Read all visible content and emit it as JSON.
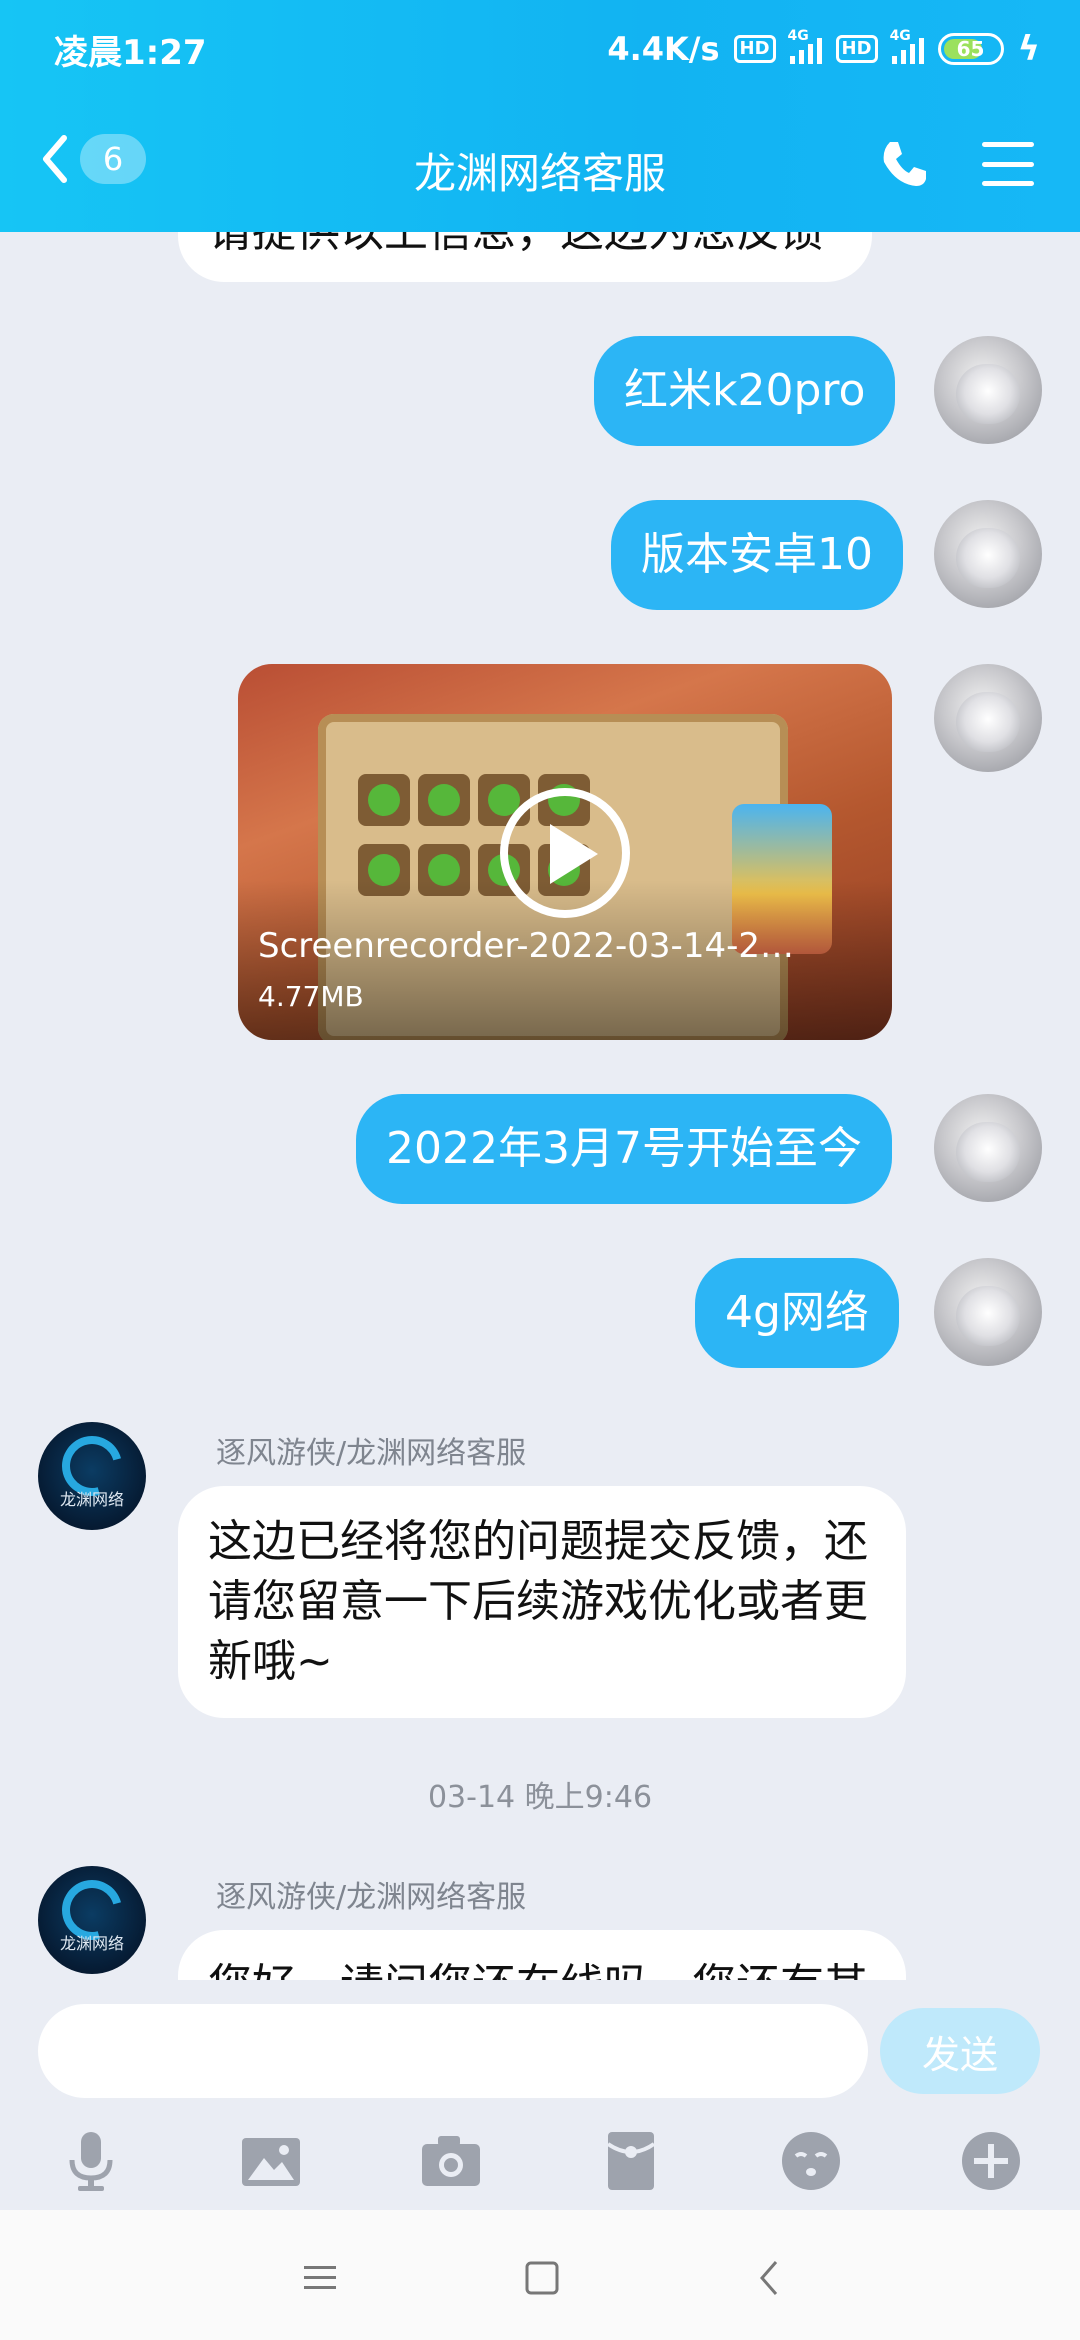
{
  "status_bar": {
    "time": "凌晨1:27",
    "network_speed": "4.4K/s",
    "hd1": "HD",
    "net1": "4G",
    "hd2": "HD",
    "net2": "4G",
    "battery": "65"
  },
  "header": {
    "unread_count": "6",
    "title": "龙渊网络客服"
  },
  "messages": {
    "m0_partial": "请提供以上信息，这边为您反馈",
    "m1": "红米k20pro",
    "m2": "版本安卓10",
    "video": {
      "name": "Screenrecorder-2022-03-14-2…",
      "size": "4.77MB"
    },
    "m3": "2022年3月7号开始至今",
    "m4": "4g网络",
    "sender1": "逐风游侠/龙渊网络客服",
    "reply1": "这边已经将您的问题提交反馈，还请您留意一下后续游戏优化或者更新哦~",
    "timestamp": "03-14 晚上9:46",
    "sender2": "逐风游侠/龙渊网络客服",
    "reply2_partial": "您好，请问您还在线吗，您还有其"
  },
  "cs_avatar_text": "龙渊网络",
  "input": {
    "placeholder": "",
    "send_label": "发送"
  },
  "toolbar": [
    "mic-icon",
    "image-icon",
    "camera-icon",
    "red-packet-icon",
    "emoji-icon",
    "plus-icon"
  ],
  "colors": {
    "header": "#12b3f2",
    "outgoing_bubble": "#2cb5f5",
    "background": "#eaedf4",
    "send_button": "#bfe9fb"
  }
}
